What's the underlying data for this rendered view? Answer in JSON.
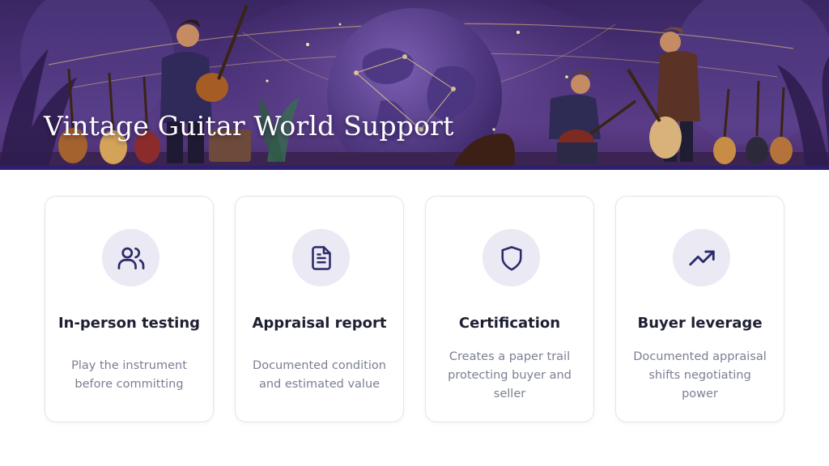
{
  "header": {
    "title": "Vintage Guitar World Support"
  },
  "colors": {
    "hero_bg": "#4a3178",
    "hero_bar": "#2e1f6e",
    "icon_bg": "#ebe9f4",
    "icon_stroke": "#2b2a6b",
    "card_title": "#1e1f33",
    "card_text": "#7a7f93"
  },
  "cards": [
    {
      "icon": "users-icon",
      "title": "In-person testing",
      "description": "Play the instrument before committing"
    },
    {
      "icon": "document-icon",
      "title": "Appraisal report",
      "description": "Documented condition and estimated value"
    },
    {
      "icon": "shield-icon",
      "title": "Certification",
      "description": "Creates a paper trail protecting buyer and seller"
    },
    {
      "icon": "trending-up-icon",
      "title": "Buyer leverage",
      "description": "Documented appraisal shifts negotiating power"
    }
  ]
}
